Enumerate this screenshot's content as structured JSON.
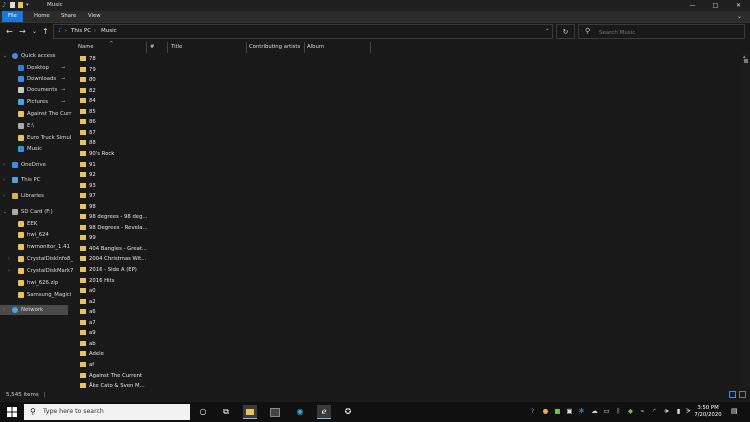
{
  "window": {
    "title": "Music",
    "min": "—",
    "max": "□",
    "close": "✕"
  },
  "ribbon": {
    "tabs": [
      "File",
      "Home",
      "Share",
      "View"
    ],
    "expand": "⌄"
  },
  "nav_buttons": {
    "back": "←",
    "forward": "→",
    "recent": "⌄",
    "up": "↑"
  },
  "address": {
    "crumbs": [
      "This PC",
      "Music"
    ],
    "separator": "›",
    "dropdown": "⌄",
    "refresh": "↻"
  },
  "search": {
    "placeholder": "Search Music",
    "icon": "search-icon"
  },
  "navpane": {
    "items": [
      {
        "label": "Quick access",
        "icon": "star-icon",
        "color": "#3b8ee0",
        "indent": 0,
        "arrow": "⌄",
        "pinned": false
      },
      {
        "label": "Desktop",
        "icon": "desktop-icon",
        "color": "#2f7fd6",
        "indent": 1,
        "arrow": "",
        "pinned": true
      },
      {
        "label": "Downloads",
        "icon": "downloads-icon",
        "color": "#3b8ee0",
        "indent": 1,
        "arrow": "",
        "pinned": true
      },
      {
        "label": "Documents",
        "icon": "documents-icon",
        "color": "#c8c8c8",
        "indent": 1,
        "arrow": "",
        "pinned": true
      },
      {
        "label": "Pictures",
        "icon": "pictures-icon",
        "color": "#4aa3e8",
        "indent": 1,
        "arrow": "",
        "pinned": true
      },
      {
        "label": "Against The Curr",
        "icon": "folder-icon",
        "color": "#e8c25a",
        "indent": 1,
        "arrow": "",
        "pinned": false
      },
      {
        "label": "E:\\",
        "icon": "drive-icon",
        "color": "#aaaaaa",
        "indent": 1,
        "arrow": "",
        "pinned": false
      },
      {
        "label": "Euro Truck Simul",
        "icon": "folder-icon",
        "color": "#e8c25a",
        "indent": 1,
        "arrow": "",
        "pinned": false
      },
      {
        "label": "Music",
        "icon": "music-icon",
        "color": "#3b8ee0",
        "indent": 1,
        "arrow": "",
        "pinned": false
      },
      {
        "label": "OneDrive",
        "icon": "cloud-icon",
        "color": "#3b8ee0",
        "indent": 0,
        "arrow": "›",
        "pinned": false
      },
      {
        "label": "This PC",
        "icon": "computer-icon",
        "color": "#4aa3e8",
        "indent": 0,
        "arrow": "›",
        "pinned": false
      },
      {
        "label": "Libraries",
        "icon": "libraries-icon",
        "color": "#d9b44a",
        "indent": 0,
        "arrow": "›",
        "pinned": false
      },
      {
        "label": "SD Card (F:)",
        "icon": "sdcard-icon",
        "color": "#aaaaaa",
        "indent": 0,
        "arrow": "⌄",
        "pinned": false
      },
      {
        "label": "EEK",
        "icon": "folder-icon",
        "color": "#e8c25a",
        "indent": 1,
        "arrow": "",
        "pinned": false
      },
      {
        "label": "hwi_624",
        "icon": "folder-icon",
        "color": "#e8c25a",
        "indent": 1,
        "arrow": "",
        "pinned": false
      },
      {
        "label": "hwmonitor_1.41",
        "icon": "folder-icon",
        "color": "#e8c25a",
        "indent": 1,
        "arrow": "",
        "pinned": false
      },
      {
        "label": "CrystalDiskInfo8_",
        "icon": "folder-icon",
        "color": "#e8c25a",
        "indent": 1,
        "arrow": "›",
        "pinned": false
      },
      {
        "label": "CrystalDiskMark7",
        "icon": "folder-icon",
        "color": "#e8c25a",
        "indent": 1,
        "arrow": "›",
        "pinned": false
      },
      {
        "label": "hwi_626.zip",
        "icon": "zip-folder-icon",
        "color": "#e8c25a",
        "indent": 1,
        "arrow": "",
        "pinned": false
      },
      {
        "label": "Samsung_Magici",
        "icon": "folder-icon",
        "color": "#e8c25a",
        "indent": 1,
        "arrow": "",
        "pinned": false
      },
      {
        "label": "Network",
        "icon": "network-icon",
        "color": "#4aa3e8",
        "indent": 0,
        "arrow": "›",
        "pinned": false,
        "selected": true
      }
    ],
    "pin_glyph": "⊸"
  },
  "columns": [
    "Name",
    "#",
    "Title",
    "Contributing artists",
    "Album"
  ],
  "sort_arrow": "^",
  "files": [
    "78",
    "79",
    "80",
    "82",
    "84",
    "85",
    "86",
    "87",
    "88",
    "90's Rock",
    "91",
    "92",
    "93",
    "97",
    "98",
    "98 degrees - 98 deg...",
    "98 Degrees - Revela...",
    "99",
    "404 Bangles - Great...",
    "2004 Christmas Wit...",
    "2016 - Side A (EP)",
    "2016 Hits",
    "a0",
    "a2",
    "a6",
    "a7",
    "a9",
    "ab",
    "Adele",
    "af",
    "Against The Current",
    "Åke Cato & Sven M..."
  ],
  "status": {
    "count": "5,545 items",
    "separator": "|"
  },
  "taskbar": {
    "search_placeholder": "Type here to search",
    "time": "3:50 PM",
    "date": "7/20/2020"
  },
  "colors": {
    "accent": "#1c78d8",
    "folder": "#e8c25a"
  }
}
